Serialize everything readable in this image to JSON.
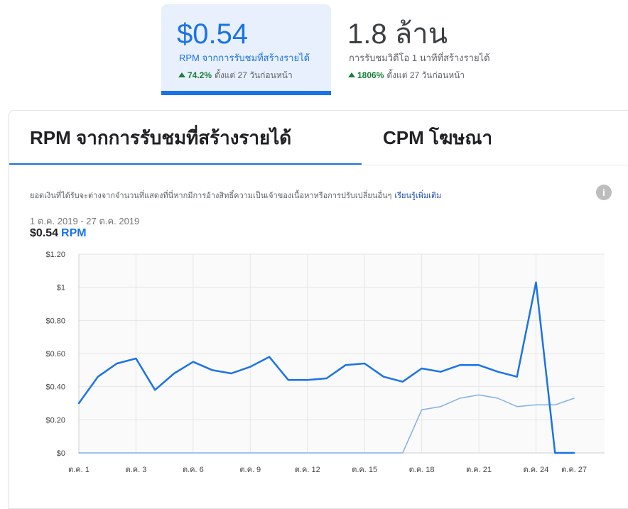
{
  "metrics": {
    "rpm": {
      "value": "$0.54",
      "label": "RPM จากการรับชมที่สร้างรายได้",
      "change_pct": "74.2%",
      "change_text": "ตั้งแต่ 27 วันก่อนหน้า"
    },
    "playbacks": {
      "value": "1.8 ล้าน",
      "label": "การรับชมวิดีโอ 1 นาทีที่สร้างรายได้",
      "change_pct": "1806%",
      "change_text": "ตั้งแต่ 27 วันก่อนหน้า"
    }
  },
  "tabs": {
    "rpm": "RPM จากการรับชมที่สร้างรายได้",
    "cpm": "CPM โฆษณา"
  },
  "info": {
    "text": "ยอดเงินที่ได้รับจะต่างจากจำนวนที่แสดงที่นี่หากมีการอ้างสิทธิ์ความเป็นเจ้าของเนื้อหาหรือการปรับเปลี่ยนอื่นๆ",
    "link": "เรียนรู้เพิ่มเติม",
    "icon": "info-icon"
  },
  "summary": {
    "date_range": "1 ต.ค. 2019 - 27 ต.ค. 2019",
    "value": "$0.54",
    "unit": "RPM"
  },
  "colors": {
    "accent": "#1a73e8",
    "accent_light": "#7fb0ea",
    "positive": "#188038"
  },
  "chart_data": {
    "type": "line",
    "x": [
      "ต.ค. 1",
      "ต.ค. 2",
      "ต.ค. 3",
      "ต.ค. 4",
      "ต.ค. 5",
      "ต.ค. 6",
      "ต.ค. 7",
      "ต.ค. 8",
      "ต.ค. 9",
      "ต.ค. 10",
      "ต.ค. 11",
      "ต.ค. 12",
      "ต.ค. 13",
      "ต.ค. 14",
      "ต.ค. 15",
      "ต.ค. 16",
      "ต.ค. 17",
      "ต.ค. 18",
      "ต.ค. 19",
      "ต.ค. 20",
      "ต.ค. 21",
      "ต.ค. 22",
      "ต.ค. 23",
      "ต.ค. 24",
      "ต.ค. 25",
      "ต.ค. 26",
      "ต.ค. 27"
    ],
    "x_tick_labels": [
      "ต.ค. 1",
      "ต.ค. 3",
      "ต.ค. 6",
      "ต.ค. 9",
      "ต.ค. 12",
      "ต.ค. 15",
      "ต.ค. 18",
      "ต.ค. 21",
      "ต.ค. 24",
      "ต.ค. 27"
    ],
    "x_tick_index": [
      0,
      3,
      6,
      9,
      12,
      15,
      18,
      21,
      24,
      27
    ],
    "y_tick_labels": [
      "$0",
      "$0.20",
      "$0.40",
      "$0.60",
      "$0.80",
      "$1",
      "$1.20"
    ],
    "y_ticks": [
      0,
      0.2,
      0.4,
      0.6,
      0.8,
      1.0,
      1.2
    ],
    "ylim": [
      0,
      1.2
    ],
    "series": [
      {
        "values": [
          0.3,
          0.46,
          0.54,
          0.57,
          0.38,
          0.48,
          0.55,
          0.5,
          0.48,
          0.52,
          0.58,
          0.44,
          0.44,
          0.45,
          0.53,
          0.54,
          0.46,
          0.43,
          0.51,
          0.49,
          0.53,
          0.53,
          0.49,
          0.46,
          1.03,
          0,
          0
        ],
        "color": "#1a73e8",
        "width": 2.5
      },
      {
        "values": [
          0,
          0,
          0,
          0,
          0,
          0,
          0,
          0,
          0,
          0,
          0,
          0,
          0,
          0,
          0,
          0,
          0,
          0,
          0.26,
          0.28,
          0.33,
          0.35,
          0.33,
          0.28,
          0.29,
          0.29,
          0.33
        ],
        "color": "#7fb0ea",
        "width": 1.5
      }
    ],
    "grid": true
  }
}
